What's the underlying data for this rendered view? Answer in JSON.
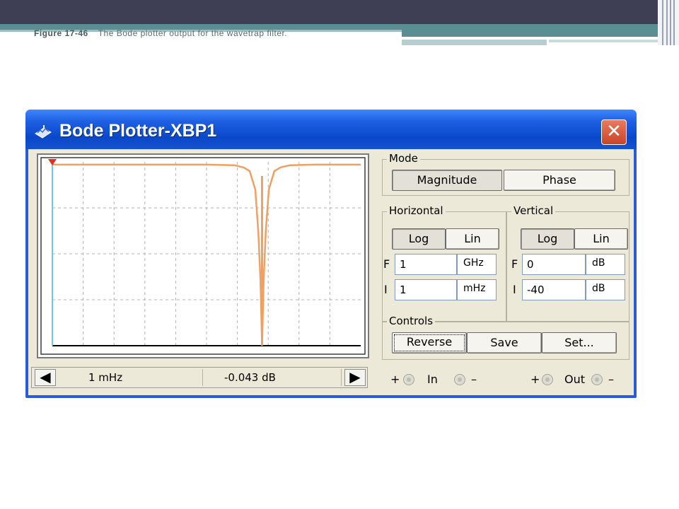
{
  "slide": {
    "figure_label": "Figure 17-46",
    "caption": "The Bode plotter output for the wavetrap filter."
  },
  "window": {
    "title": "Bode Plotter-XBP1",
    "close_glyph": "✕"
  },
  "plot": {
    "trace_color": "#f0a060",
    "cursor_color": "#6ec8e8",
    "marker_color": "#e03020",
    "trace_points": [
      [
        0.0,
        0.985
      ],
      [
        0.5,
        0.985
      ],
      [
        0.59,
        0.982
      ],
      [
        0.62,
        0.97
      ],
      [
        0.64,
        0.95
      ],
      [
        0.658,
        0.85
      ],
      [
        0.668,
        0.62
      ],
      [
        0.675,
        0.35
      ],
      [
        0.68,
        0.0
      ],
      [
        0.685,
        0.35
      ],
      [
        0.692,
        0.62
      ],
      [
        0.702,
        0.85
      ],
      [
        0.72,
        0.95
      ],
      [
        0.74,
        0.97
      ],
      [
        0.77,
        0.982
      ],
      [
        0.85,
        0.985
      ],
      [
        1.0,
        0.985
      ]
    ],
    "notch_position": 0.68
  },
  "status": {
    "left_arrow": "◀",
    "right_arrow": "▶",
    "frequency": "1 mHz",
    "magnitude": "-0.043 dB"
  },
  "mode": {
    "title": "Mode",
    "magnitude": "Magnitude",
    "phase": "Phase"
  },
  "horizontal": {
    "title": "Horizontal",
    "log": "Log",
    "lin": "Lin",
    "f_label": "F",
    "i_label": "I",
    "f_value": "1",
    "f_unit": "GHz",
    "i_value": "1",
    "i_unit": "mHz"
  },
  "vertical": {
    "title": "Vertical",
    "log": "Log",
    "lin": "Lin",
    "f_label": "F",
    "i_label": "I",
    "f_value": "0",
    "f_unit": "dB",
    "i_value": "-40",
    "i_unit": "dB"
  },
  "controls": {
    "title": "Controls",
    "reverse": "Reverse",
    "save": "Save",
    "set": "Set..."
  },
  "terminals": {
    "plus": "+",
    "minus": "–",
    "in": "In",
    "out": "Out"
  }
}
